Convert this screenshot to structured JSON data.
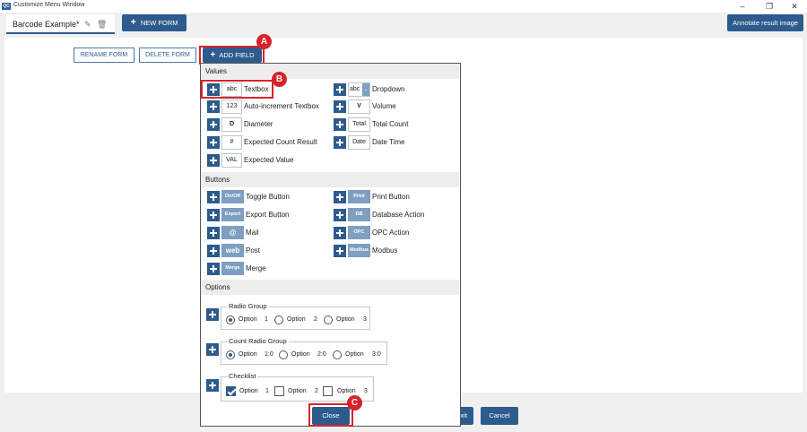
{
  "window": {
    "title": "Customize Menu Window",
    "app_icon": "app-logo",
    "min": "–",
    "max": "❐",
    "close": "✕"
  },
  "toolbar": {
    "tab_label": "Barcode Example*",
    "new_form": "NEW FORM",
    "annotate": "Annotate result image"
  },
  "form_actions": {
    "rename": "RENAME FORM",
    "delete": "DELETE FORM",
    "add_field": "ADD FIELD"
  },
  "markers": {
    "a": "A",
    "b": "B",
    "c": "C"
  },
  "dialog": {
    "sections": {
      "values": "Values",
      "buttons": "Buttons",
      "options": "Options"
    },
    "values_left": [
      {
        "chip": "abc",
        "label": "Textbox"
      },
      {
        "chip": "123",
        "label": "Auto-increment Textbox"
      },
      {
        "chip": "D",
        "label": "Diameter"
      },
      {
        "chip": "#",
        "label": "Expected Count Result"
      },
      {
        "chip": "VAL",
        "label": "Expected Value"
      }
    ],
    "values_right": [
      {
        "chip": "abc",
        "label": "Dropdown"
      },
      {
        "chip": "V",
        "label": "Volume"
      },
      {
        "chip": "Total",
        "label": "Total Count"
      },
      {
        "chip": "Date",
        "label": "Date Time"
      }
    ],
    "buttons_left": [
      {
        "badge": "On/Off",
        "label": "Toggle Button"
      },
      {
        "badge": "Export",
        "label": "Export Button"
      },
      {
        "badge": "@",
        "label": "Mail"
      },
      {
        "badge": "web",
        "label": "Post"
      },
      {
        "badge": "Merge",
        "label": "Merge"
      }
    ],
    "buttons_right": [
      {
        "badge": "Print",
        "label": "Print Button"
      },
      {
        "badge": "DB",
        "label": "Database Action"
      },
      {
        "badge": "OPC",
        "label": "OPC Action"
      },
      {
        "badge": "Modbus",
        "label": "Modbus"
      }
    ],
    "radio_group": {
      "title": "Radio Group",
      "options": [
        {
          "text": "Option",
          "num": "1"
        },
        {
          "text": "Option",
          "num": "2"
        },
        {
          "text": "Option",
          "num": "3"
        }
      ]
    },
    "count_radio_group": {
      "title": "Count Radio Group",
      "options": [
        {
          "text": "Option",
          "num": "1:0"
        },
        {
          "text": "Option",
          "num": "2:0"
        },
        {
          "text": "Option",
          "num": "3:0"
        }
      ]
    },
    "checklist": {
      "title": "Checklist",
      "options": [
        {
          "text": "Option",
          "num": "1"
        },
        {
          "text": "Option",
          "num": "2"
        },
        {
          "text": "Option",
          "num": "3"
        }
      ]
    },
    "close": "Close"
  },
  "bottom": {
    "exit": "xit",
    "cancel": "Cancel"
  },
  "colors": {
    "accent": "#2d5b8d",
    "highlight": "#d9222a",
    "badge": "#7e9ec2"
  }
}
